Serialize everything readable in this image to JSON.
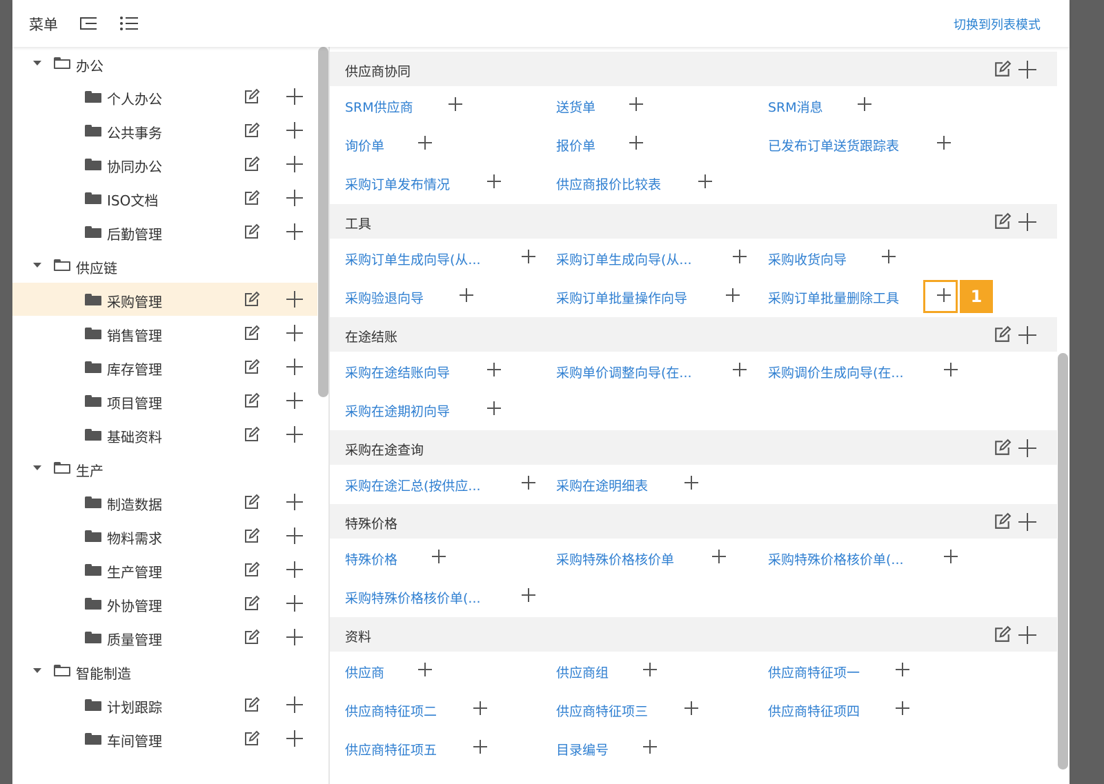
{
  "header": {
    "title": "菜单",
    "icons": [
      "indent-list-icon",
      "bullet-list-icon"
    ],
    "switch_label": "切换到列表模式"
  },
  "tree": {
    "groups": [
      {
        "label": "办公",
        "expanded": true,
        "children": [
          "个人办公",
          "公共事务",
          "协同办公",
          "ISO文档",
          "后勤管理"
        ]
      },
      {
        "label": "供应链",
        "expanded": true,
        "children": [
          "采购管理",
          "销售管理",
          "库存管理",
          "项目管理",
          "基础资料"
        ]
      },
      {
        "label": "生产",
        "expanded": true,
        "children": [
          "制造数据",
          "物料需求",
          "生产管理",
          "外协管理",
          "质量管理"
        ]
      },
      {
        "label": "智能制造",
        "expanded": true,
        "children": [
          "计划跟踪",
          "车间管理"
        ]
      }
    ],
    "selected": "采购管理"
  },
  "sections": [
    {
      "title": "供应商协同",
      "items": [
        "SRM供应商",
        "送货单",
        "SRM消息",
        "询价单",
        "报价单",
        "已发布订单送货跟踪表",
        "采购订单发布情况",
        "供应商报价比较表"
      ]
    },
    {
      "title": "工具",
      "items": [
        "采购订单生成向导(从...",
        "采购订单生成向导(从...",
        "采购收货向导",
        "采购验退向导",
        "采购订单批量操作向导",
        "采购订单批量删除工具"
      ]
    },
    {
      "title": "在途结账",
      "items": [
        "采购在途结账向导",
        "采购单价调整向导(在...",
        "采购调价生成向导(在...",
        "采购在途期初向导"
      ]
    },
    {
      "title": "采购在途查询",
      "items": [
        "采购在途汇总(按供应...",
        "采购在途明细表"
      ]
    },
    {
      "title": "特殊价格",
      "items": [
        "特殊价格",
        "采购特殊价格核价单",
        "采购特殊价格核价单(...",
        "采购特殊价格核价单(..."
      ]
    },
    {
      "title": "资料",
      "items": [
        "供应商",
        "供应商组",
        "供应商特征项一",
        "供应商特征项二",
        "供应商特征项三",
        "供应商特征项四",
        "供应商特征项五",
        "目录编号"
      ]
    }
  ],
  "highlight": {
    "badge": "1"
  },
  "colors": {
    "link": "#2f7fd1",
    "highlight": "#f5a623",
    "selected_row": "#fdf1dd"
  }
}
